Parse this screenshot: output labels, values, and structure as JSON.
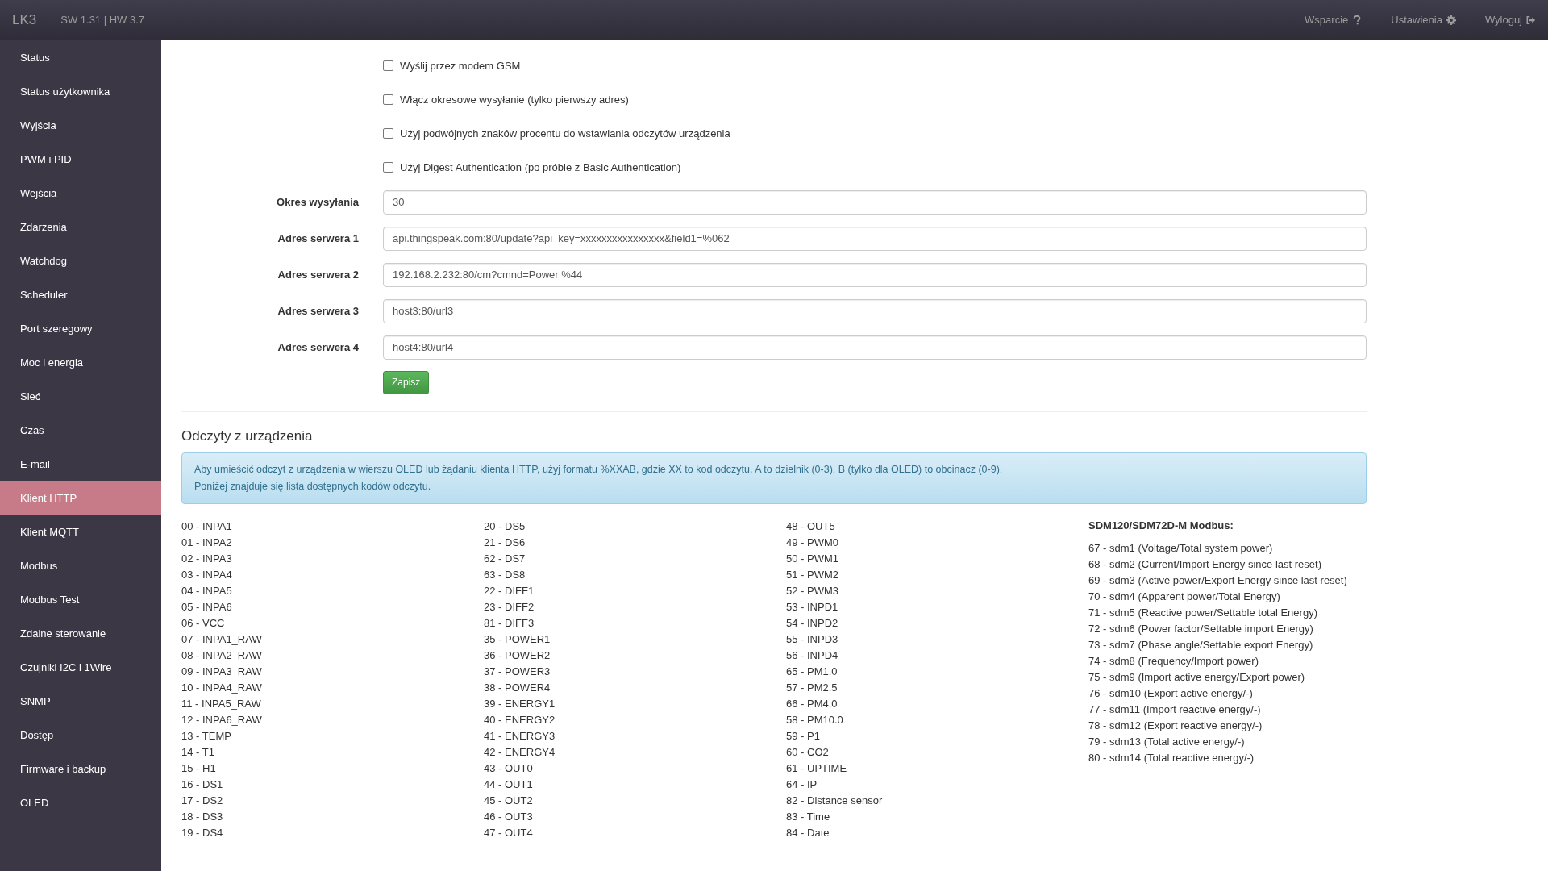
{
  "topbar": {
    "brand": "LK3",
    "version": "SW 1.31 | HW 3.7",
    "nav": [
      {
        "label": "Wsparcie",
        "kind": "help"
      },
      {
        "label": "Ustawienia",
        "kind": "gear"
      },
      {
        "label": "Wyloguj",
        "kind": "logout"
      }
    ]
  },
  "sidebar": {
    "items": [
      {
        "label": "Status",
        "selected": false
      },
      {
        "label": "Status użytkownika",
        "selected": false
      },
      {
        "label": "Wyjścia",
        "selected": false
      },
      {
        "label": "PWM i PID",
        "selected": false
      },
      {
        "label": "Wejścia",
        "selected": false
      },
      {
        "label": "Zdarzenia",
        "selected": false
      },
      {
        "label": "Watchdog",
        "selected": false
      },
      {
        "label": "Scheduler",
        "selected": false
      },
      {
        "label": "Port szeregowy",
        "selected": false
      },
      {
        "label": "Moc i energia",
        "selected": false
      },
      {
        "label": "Sieć",
        "selected": false
      },
      {
        "label": "Czas",
        "selected": false
      },
      {
        "label": "E-mail",
        "selected": false
      },
      {
        "label": "Klient HTTP",
        "selected": true
      },
      {
        "label": "Klient MQTT",
        "selected": false
      },
      {
        "label": "Modbus",
        "selected": false
      },
      {
        "label": "Modbus Test",
        "selected": false
      },
      {
        "label": "Zdalne sterowanie",
        "selected": false
      },
      {
        "label": "Czujniki I2C i 1Wire",
        "selected": false
      },
      {
        "label": "SNMP",
        "selected": false
      },
      {
        "label": "Dostęp",
        "selected": false
      },
      {
        "label": "Firmware i backup",
        "selected": false
      },
      {
        "label": "OLED",
        "selected": false
      }
    ]
  },
  "form": {
    "checkboxes": [
      {
        "label": "Wyślij przez modem GSM",
        "checked": false
      },
      {
        "label": "Włącz okresowe wysyłanie (tylko pierwszy adres)",
        "checked": false
      },
      {
        "label": "Użyj podwójnych znaków procentu do wstawiania odczytów urządzenia",
        "checked": false
      },
      {
        "label": "Użyj Digest Authentication (po próbie z Basic Authentication)",
        "checked": false
      }
    ],
    "fields": [
      {
        "label": "Okres wysyłania",
        "value": "30"
      },
      {
        "label": "Adres serwera 1",
        "value": "api.thingspeak.com:80/update?api_key=xxxxxxxxxxxxxxxx&field1=%062"
      },
      {
        "label": "Adres serwera 2",
        "value": "192.168.2.232:80/cm?cmnd=Power %44"
      },
      {
        "label": "Adres serwera 3",
        "value": "host3:80/url3"
      },
      {
        "label": "Adres serwera 4",
        "value": "host4:80/url4"
      }
    ],
    "save_button": "Zapisz"
  },
  "readings": {
    "title": "Odczyty z urządzenia",
    "info": [
      "Aby umieścić odczyt z urządzenia w wierszu OLED lub żądaniu klienta HTTP, użyj formatu %XXAB, gdzie XX to kod odczytu, A to dzielnik (0-3), B (tylko dla OLED) to obcinacz (0-9).",
      "Poniżej znajduje się lista dostępnych kodów odczytu."
    ],
    "columns": [
      [
        "00 - INPA1",
        "01 - INPA2",
        "02 - INPA3",
        "03 - INPA4",
        "04 - INPA5",
        "05 - INPA6",
        "06 - VCC",
        "07 - INPA1_RAW",
        "08 - INPA2_RAW",
        "09 - INPA3_RAW",
        "10 - INPA4_RAW",
        "11 - INPA5_RAW",
        "12 - INPA6_RAW",
        "13 - TEMP",
        "14 - T1",
        "15 - H1",
        "16 - DS1",
        "17 - DS2",
        "18 - DS3",
        "19 - DS4"
      ],
      [
        "20 - DS5",
        "21 - DS6",
        "62 - DS7",
        "63 - DS8",
        "22 - DIFF1",
        "23 - DIFF2",
        "81 - DIFF3",
        "35 - POWER1",
        "36 - POWER2",
        "37 - POWER3",
        "38 - POWER4",
        "39 - ENERGY1",
        "40 - ENERGY2",
        "41 - ENERGY3",
        "42 - ENERGY4",
        "43 - OUT0",
        "44 - OUT1",
        "45 - OUT2",
        "46 - OUT3",
        "47 - OUT4"
      ],
      [
        "48 - OUT5",
        "49 - PWM0",
        "50 - PWM1",
        "51 - PWM2",
        "52 - PWM3",
        "53 - INPD1",
        "54 - INPD2",
        "55 - INPD3",
        "56 - INPD4",
        "65 - PM1.0",
        "57 - PM2.5",
        "66 - PM4.0",
        "58 - PM10.0",
        "59 - P1",
        "60 - CO2",
        "61 - UPTIME",
        "64 - IP",
        "82 - Distance sensor",
        "83 - Time",
        "84 - Date"
      ]
    ],
    "sdm": {
      "title": "SDM120/SDM72D-M Modbus:",
      "items": [
        "67 - sdm1 (Voltage/Total system power)",
        "68 - sdm2 (Current/Import Energy since last reset)",
        "69 - sdm3 (Active power/Export Energy since last reset)",
        "70 - sdm4 (Apparent power/Total Energy)",
        "71 - sdm5 (Reactive power/Settable total Energy)",
        "72 - sdm6 (Power factor/Settable import Energy)",
        "73 - sdm7 (Phase angle/Settable export Energy)",
        "74 - sdm8 (Frequency/Import power)",
        "75 - sdm9 (Import active energy/Export power)",
        "76 - sdm10 (Export active energy/-)",
        "77 - sdm11 (Import reactive energy/-)",
        "78 - sdm12 (Export reactive energy/-)",
        "79 - sdm13 (Total active energy/-)",
        "80 - sdm14 (Total reactive energy/-)"
      ]
    }
  }
}
